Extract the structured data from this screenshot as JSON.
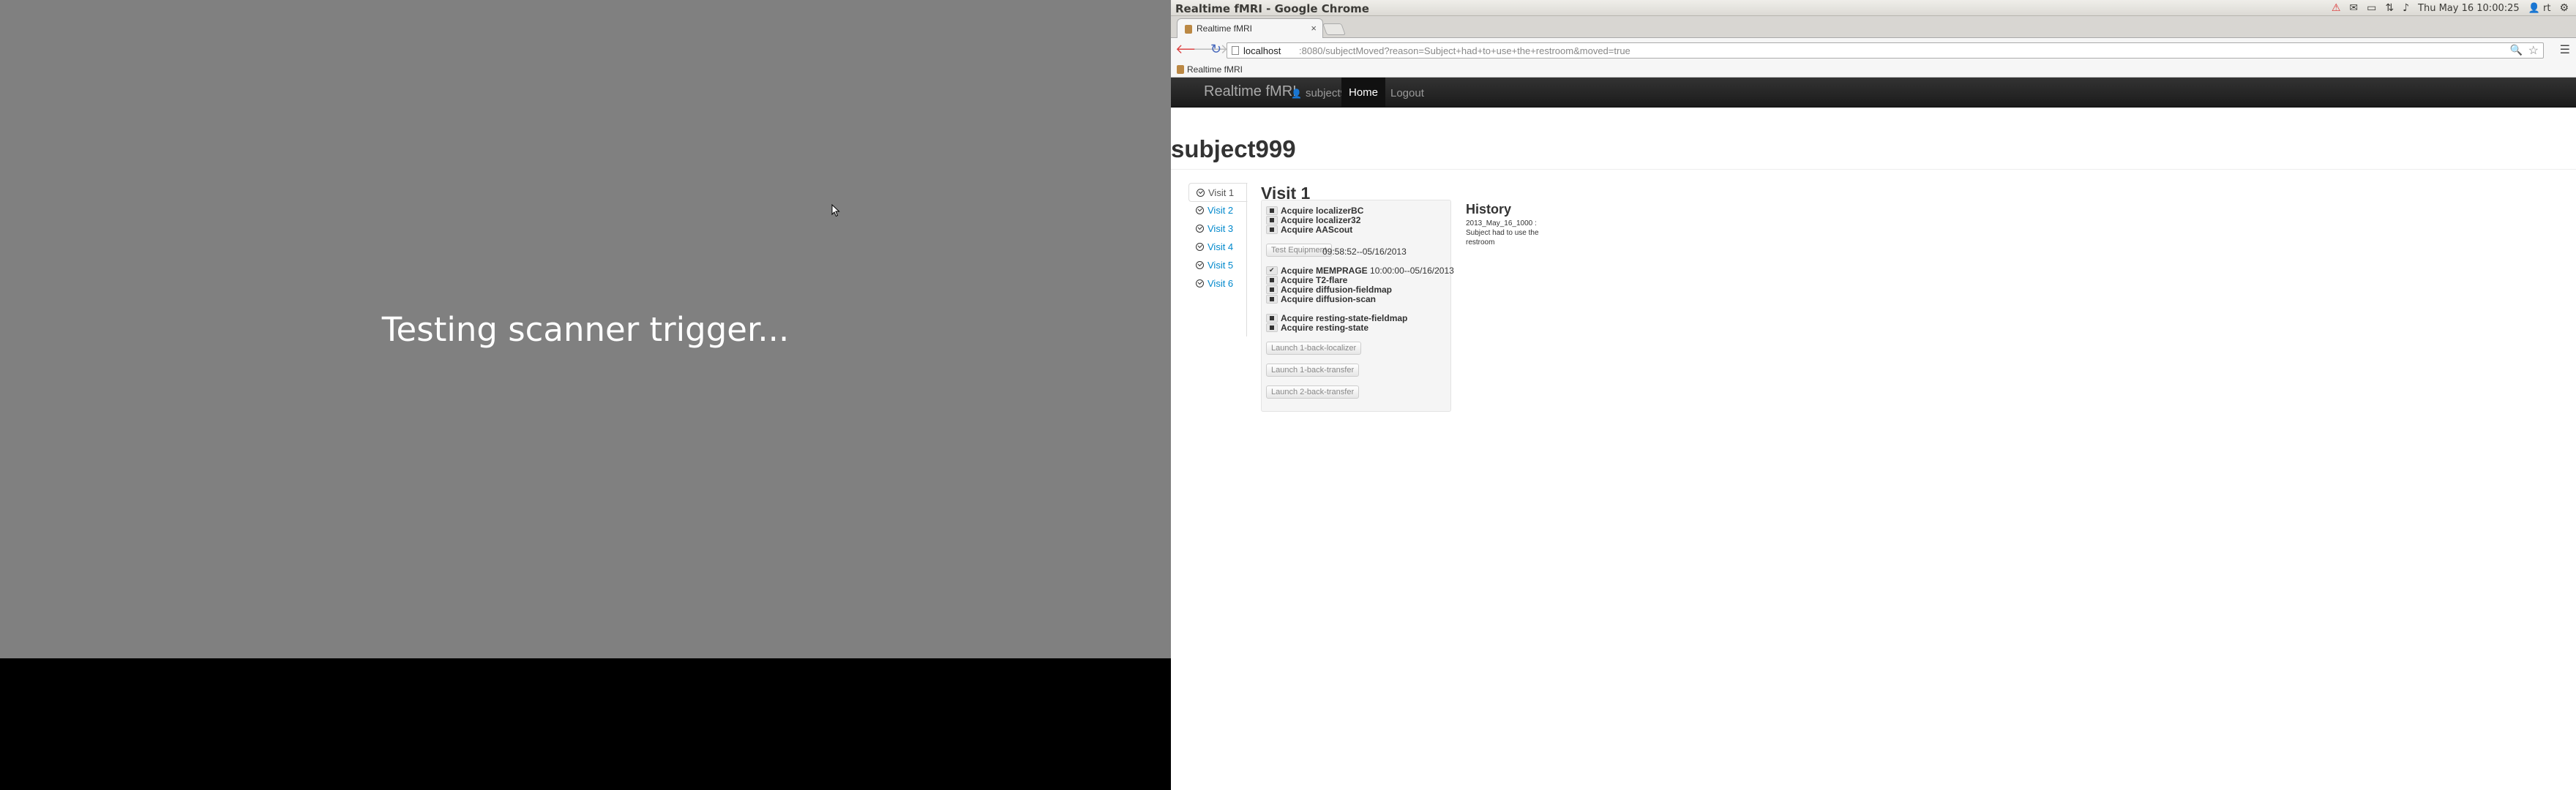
{
  "left_screen": {
    "message": "Testing scanner trigger..."
  },
  "os_bar": {
    "window_title": "Realtime fMRI - Google Chrome",
    "datetime": "Thu May 16 10:00:25",
    "user": "rt"
  },
  "browser": {
    "tab_title": "Realtime fMRI",
    "tab_close": "×",
    "url_host": "localhost",
    "url_rest": ":8080/subjectMoved?reason=Subject+had+to+use+the+restroom&moved=true",
    "bookmark": "Realtime fMRI"
  },
  "navbar": {
    "brand": "Realtime fMRI",
    "user": "subject999",
    "home": "Home",
    "logout": "Logout"
  },
  "page": {
    "header": "subject999"
  },
  "visits": [
    {
      "label": "Visit 1",
      "active": true
    },
    {
      "label": "Visit 2",
      "active": false
    },
    {
      "label": "Visit 3",
      "active": false
    },
    {
      "label": "Visit 4",
      "active": false
    },
    {
      "label": "Visit 5",
      "active": false
    },
    {
      "label": "Visit 6",
      "active": false
    }
  ],
  "visit_panel": {
    "title": "Visit 1",
    "tasks": [
      {
        "name": "Acquire localizerBC",
        "status": "pending",
        "time": ""
      },
      {
        "name": "Acquire localizer32",
        "status": "pending",
        "time": ""
      },
      {
        "name": "Acquire AAScout",
        "status": "pending",
        "time": ""
      },
      {
        "name": "Acquire MEMPRAGE",
        "status": "done",
        "time": "10:00:00--05/16/2013"
      },
      {
        "name": "Acquire T2-flare",
        "status": "pending",
        "time": ""
      },
      {
        "name": "Acquire diffusion-fieldmap",
        "status": "pending",
        "time": ""
      },
      {
        "name": "Acquire diffusion-scan",
        "status": "pending",
        "time": ""
      },
      {
        "name": "Acquire resting-state-fieldmap",
        "status": "pending",
        "time": ""
      },
      {
        "name": "Acquire resting-state",
        "status": "pending",
        "time": ""
      }
    ],
    "test_equipment": {
      "label": "Test Equipment",
      "time": "09:58:52--05/16/2013"
    },
    "launch_buttons": [
      "Launch 1-back-localizer",
      "Launch 1-back-transfer",
      "Launch 2-back-transfer"
    ]
  },
  "history": {
    "title": "History",
    "entry": "2013_May_16_1000 : Subject had to use the restroom"
  }
}
